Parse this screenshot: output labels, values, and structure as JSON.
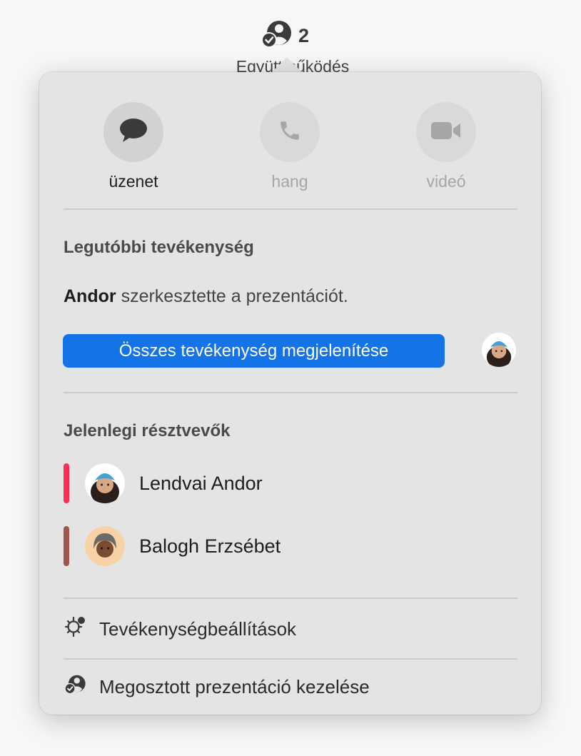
{
  "toolbar": {
    "collab_count": "2",
    "collab_label": "Együttműködés"
  },
  "popover": {
    "comm": {
      "message_label": "üzenet",
      "audio_label": "hang",
      "video_label": "videó"
    },
    "recent": {
      "heading": "Legutóbbi tevékenység",
      "actor": "Andor",
      "action_text": "szerkesztette a prezentációt.",
      "show_all_button": "Összes tevékenység megjelenítése"
    },
    "participants": {
      "heading": "Jelenlegi résztvevők",
      "items": [
        {
          "name": "Lendvai Andor",
          "color": "#ff2d55"
        },
        {
          "name": "Balogh Erzsébet",
          "color": "#a2554c"
        }
      ]
    },
    "menu": {
      "activity_settings": "Tevékenységbeállítások",
      "manage_shared": "Megosztott prezentáció kezelése"
    }
  },
  "colors": {
    "accent": "#1473e6",
    "popover_bg": "#e4e4e4"
  }
}
